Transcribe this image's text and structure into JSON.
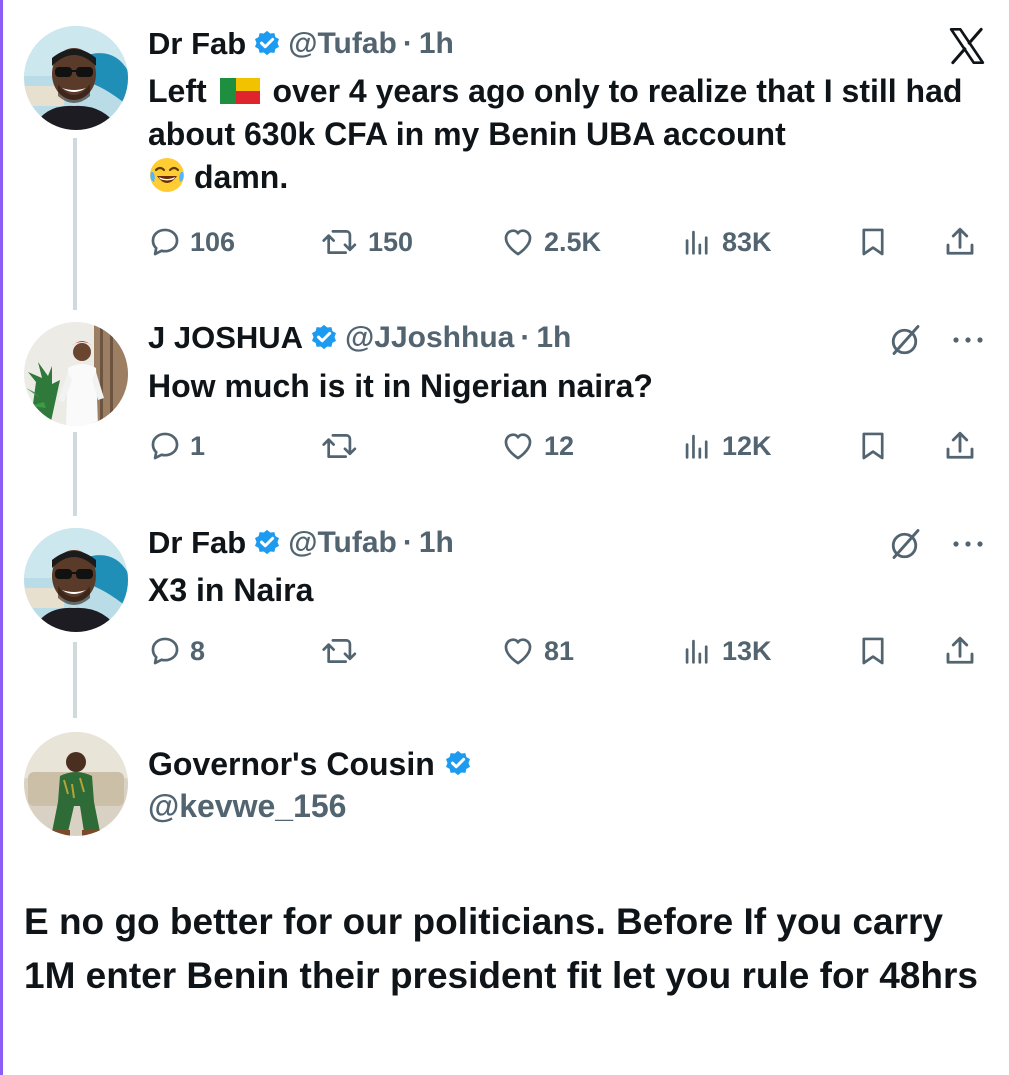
{
  "tweets": [
    {
      "name": "Dr Fab",
      "handle": "@Tufab",
      "time": "1h",
      "text_part1": "Left",
      "text_part2": "over 4 years ago only to realize that I still had about 630k CFA in my Benin UBA account",
      "text_part3": "damn.",
      "replies": "106",
      "reposts": "150",
      "likes": "2.5K",
      "views": "83K"
    },
    {
      "name": "J JOSHUA",
      "handle": "@JJoshhua",
      "time": "1h",
      "text": "How much is it in Nigerian naira?",
      "replies": "1",
      "reposts": "",
      "likes": "12",
      "views": "12K"
    },
    {
      "name": "Dr Fab",
      "handle": "@Tufab",
      "time": "1h",
      "text": "X3 in Naira",
      "replies": "8",
      "reposts": "",
      "likes": "81",
      "views": "13K"
    }
  ],
  "quote": {
    "name": "Governor's Cousin",
    "handle": "@kevwe_156",
    "text": "E no go better for  our politicians. Before If you carry 1M enter Benin their president fit let you rule for 48hrs"
  },
  "icons": {
    "platform": "x-logo-icon",
    "verified": "verified-badge-icon",
    "reply": "reply-icon",
    "repost": "repost-icon",
    "like": "heart-icon",
    "views": "views-icon",
    "bookmark": "bookmark-icon",
    "share": "share-icon",
    "grok": "grok-icon",
    "more": "more-icon"
  },
  "colors": {
    "verified": "#1d9bf0",
    "secondary_text": "#536471",
    "thread_line": "#cfd9de",
    "frame": "#8b5cf6"
  }
}
